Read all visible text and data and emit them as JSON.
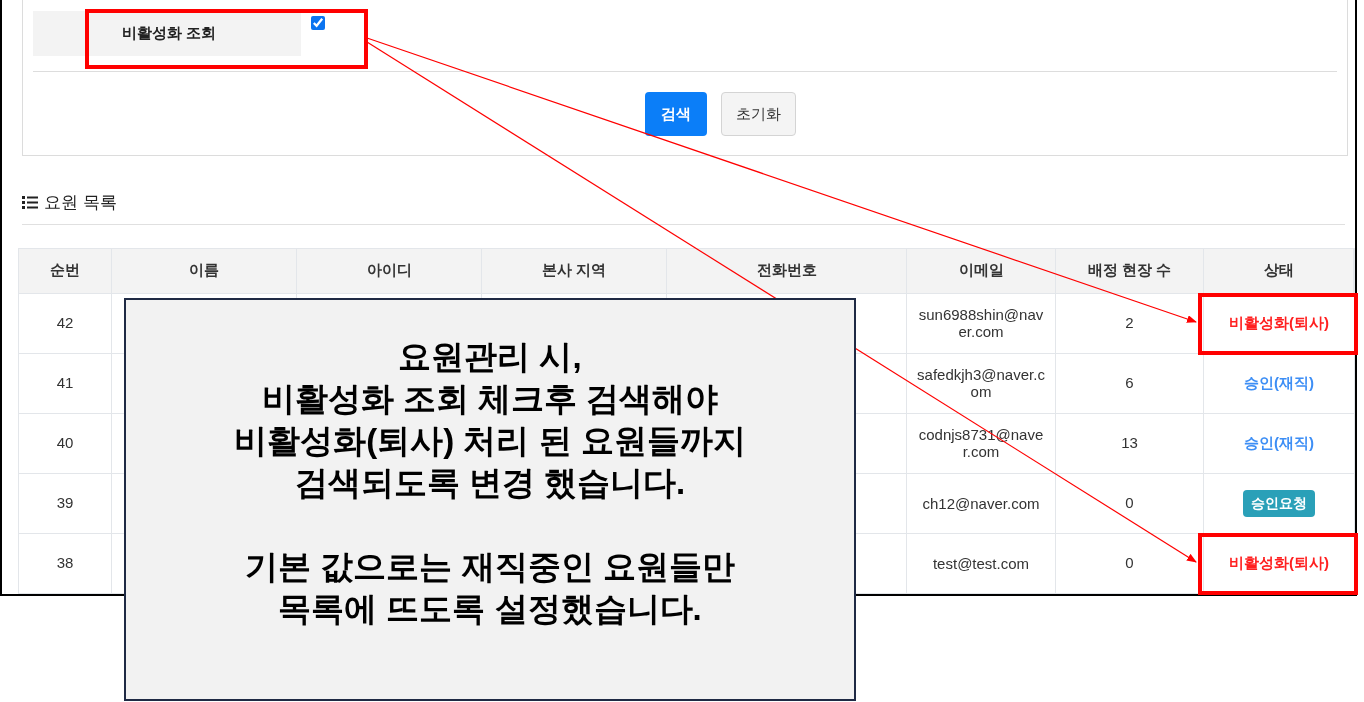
{
  "filter": {
    "label": "비활성화 조회",
    "checked": true,
    "highlighted": true
  },
  "buttons": [
    {
      "label": "검색",
      "kind": "primary"
    },
    {
      "label": "초기화",
      "kind": "secondary"
    }
  ],
  "section_title": "요원 목록",
  "table": {
    "columns": [
      "순번",
      "이름",
      "아이디",
      "본사 지역",
      "전화번호",
      "이메일",
      "배정 현장 수",
      "상태"
    ],
    "rows": [
      {
        "no": "42",
        "email": "sun6988shin@naver.com",
        "sites": "2",
        "status": {
          "label": "비활성화(퇴사)",
          "kind": "inactive"
        },
        "highlighted": true
      },
      {
        "no": "41",
        "email": "safedkjh3@naver.com",
        "sites": "6",
        "status": {
          "label": "승인(재직)",
          "kind": "approved"
        },
        "highlighted": false
      },
      {
        "no": "40",
        "email": "codnjs8731@naver.com",
        "sites": "13",
        "status": {
          "label": "승인(재직)",
          "kind": "approved"
        },
        "highlighted": false
      },
      {
        "no": "39",
        "email": "ch12@naver.com",
        "sites": "0",
        "status": {
          "label": "승인요청",
          "kind": "request"
        },
        "highlighted": false
      },
      {
        "no": "38",
        "email": "test@test.com",
        "sites": "0",
        "status": {
          "label": "비활성화(퇴사)",
          "kind": "inactive"
        },
        "highlighted": true
      }
    ]
  },
  "callout": {
    "paragraphs": [
      [
        "요원관리 시,",
        "비활성화 조회 체크후 검색해야",
        "비활성화(퇴사) 처리 된 요원들까지",
        "검색되도록 변경 했습니다."
      ],
      [
        "기본 값으로는 재직중인 요원들만",
        "목록에 뜨도록 설정했습니다."
      ]
    ]
  }
}
